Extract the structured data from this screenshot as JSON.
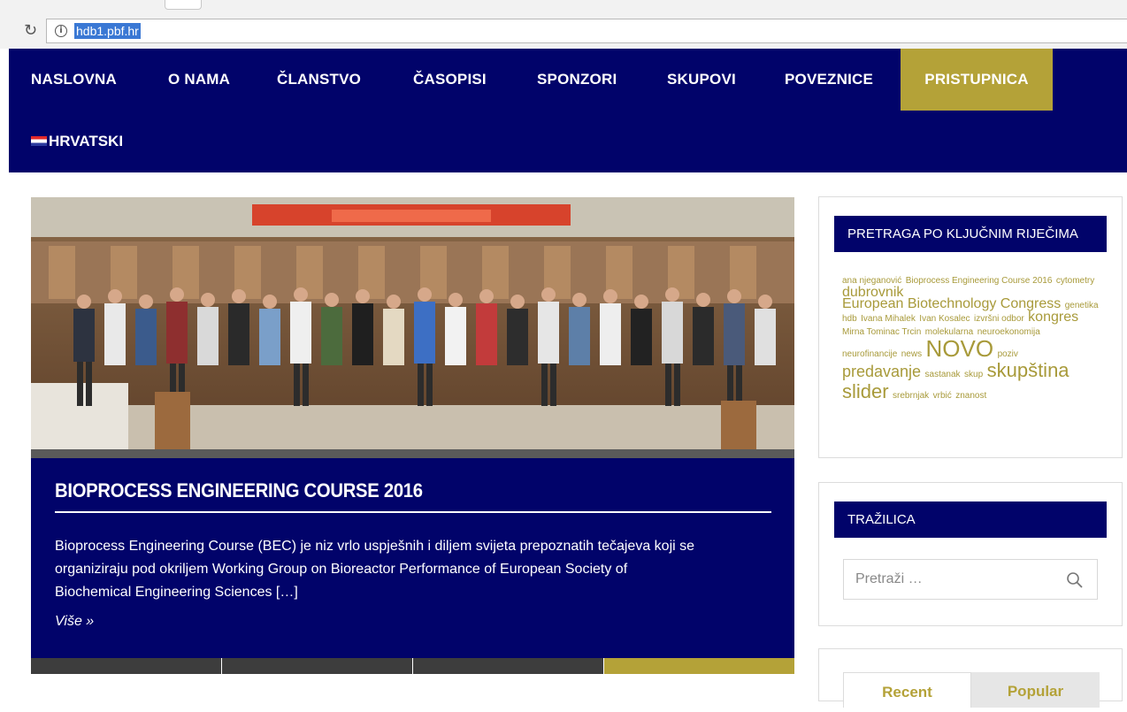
{
  "browser": {
    "url": "hdb1.pbf.hr",
    "reload_icon": "reload-icon",
    "info_icon": "info-icon"
  },
  "nav": {
    "items": [
      {
        "label": "NASLOVNA"
      },
      {
        "label": "O NAMA"
      },
      {
        "label": "ČLANSTVO"
      },
      {
        "label": "ČASOPISI"
      },
      {
        "label": "SPONZORI"
      },
      {
        "label": "SKUPOVI"
      },
      {
        "label": "POVEZNICE"
      },
      {
        "label": "PRISTUPNICA",
        "active": true
      }
    ],
    "language": "HRVATSKI",
    "language_icon": "croatian-flag-icon"
  },
  "article": {
    "title": "BIOPROCESS ENGINEERING COURSE 2016",
    "excerpt_lines": [
      "Bioprocess Engineering Course (BEC) je niz vrlo uspješnih i diljem svijeta prepoznatih tečajeva koji se",
      "organiziraju pod okriljem Working Group on Bioreactor Performance of European Society of",
      "Biochemical Engineering Sciences […]"
    ],
    "more_link": "Više »"
  },
  "sidebar": {
    "tags_widget": {
      "title": "PRETRAGA PO KLJUČNIM RIJEČIMA",
      "tags": [
        {
          "label": "ana njeganović",
          "size": 10
        },
        {
          "label": "Bioprocess Engineering Course 2016",
          "size": 10
        },
        {
          "label": "cytometry",
          "size": 10
        },
        {
          "label": "dubrovnik",
          "size": 16
        },
        {
          "label": "European Biotechnology Congress",
          "size": 16
        },
        {
          "label": "genetika",
          "size": 10
        },
        {
          "label": "hdb",
          "size": 10
        },
        {
          "label": "Ivana Mihalek",
          "size": 10
        },
        {
          "label": "Ivan Kosalec",
          "size": 10
        },
        {
          "label": "izvršni odbor",
          "size": 10
        },
        {
          "label": "kongres",
          "size": 16
        },
        {
          "label": "Mirna Tominac Trcin",
          "size": 10
        },
        {
          "label": "molekularna",
          "size": 10
        },
        {
          "label": "neuroekonomija",
          "size": 10
        },
        {
          "label": "neurofinancije",
          "size": 10
        },
        {
          "label": "news",
          "size": 10
        },
        {
          "label": "NOVO",
          "size": 26
        },
        {
          "label": "poziv",
          "size": 10
        },
        {
          "label": "predavanje",
          "size": 18
        },
        {
          "label": "sastanak",
          "size": 10
        },
        {
          "label": "skup",
          "size": 10
        },
        {
          "label": "skupština",
          "size": 22
        },
        {
          "label": "slider",
          "size": 22
        },
        {
          "label": "srebrnjak",
          "size": 10
        },
        {
          "label": "vrbić",
          "size": 10
        },
        {
          "label": "znanost",
          "size": 10
        }
      ]
    },
    "search_widget": {
      "title": "TRAŽILICA",
      "placeholder": "Pretraži …"
    },
    "posts_widget": {
      "tabs": [
        {
          "label": "Recent"
        },
        {
          "label": "Popular"
        }
      ]
    }
  },
  "colors": {
    "navy": "#01036a",
    "gold": "#b4a238",
    "tag_gold": "#a89a3a"
  }
}
